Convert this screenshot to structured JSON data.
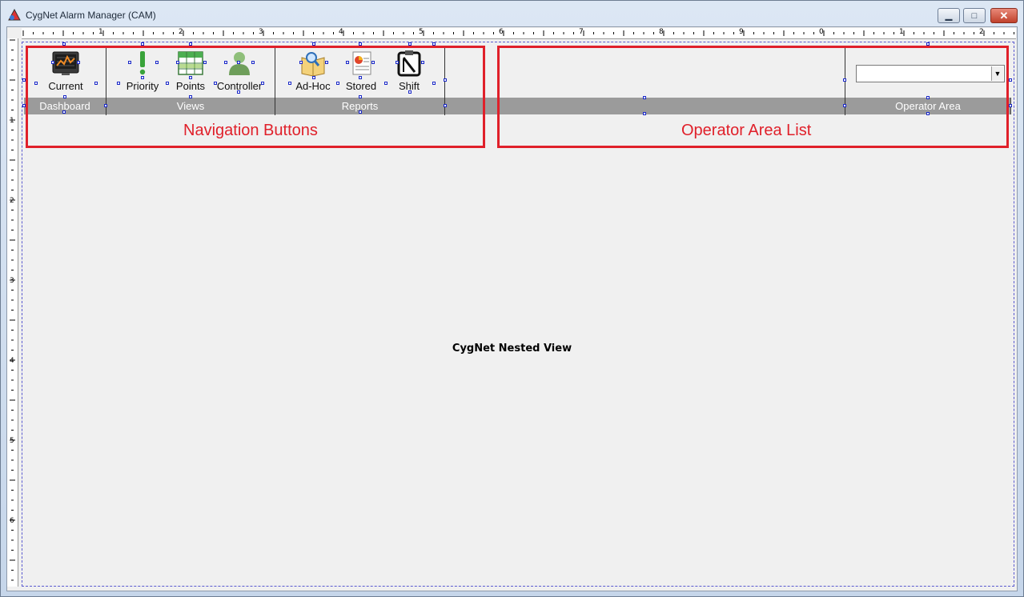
{
  "window": {
    "title": "CygNet Alarm Manager (CAM)",
    "minimize": "▁",
    "maximize": "□",
    "close": "✕"
  },
  "rulers": {
    "horizontal": [
      "1",
      "2",
      "3",
      "4",
      "5",
      "6",
      "7",
      "8",
      "9",
      "0",
      "1",
      "2"
    ],
    "vertical": [
      "1",
      "2",
      "3",
      "4",
      "5",
      "6"
    ]
  },
  "groups": [
    {
      "label": "Dashboard",
      "buttons": [
        {
          "label": "Current",
          "icon": "current-chart-icon"
        }
      ]
    },
    {
      "label": "Views",
      "buttons": [
        {
          "label": "Priority",
          "icon": "exclamation-icon"
        },
        {
          "label": "Points",
          "icon": "grid-table-icon"
        },
        {
          "label": "Controller",
          "icon": "person-icon"
        }
      ]
    },
    {
      "label": "Reports",
      "buttons": [
        {
          "label": "Ad-Hoc",
          "icon": "magnifier-book-icon"
        },
        {
          "label": "Stored",
          "icon": "document-icon"
        },
        {
          "label": "Shift",
          "icon": "clipboard-icon"
        }
      ]
    }
  ],
  "operator_area": {
    "label": "Operator Area",
    "selected": ""
  },
  "annotations": {
    "navigation": "Navigation Buttons",
    "operator_list": "Operator Area List"
  },
  "nested_view": "CygNet Nested View",
  "colors": {
    "annotation": "#e0202a",
    "group_bar": "#9b9b9b",
    "handle": "#1a28c8"
  }
}
